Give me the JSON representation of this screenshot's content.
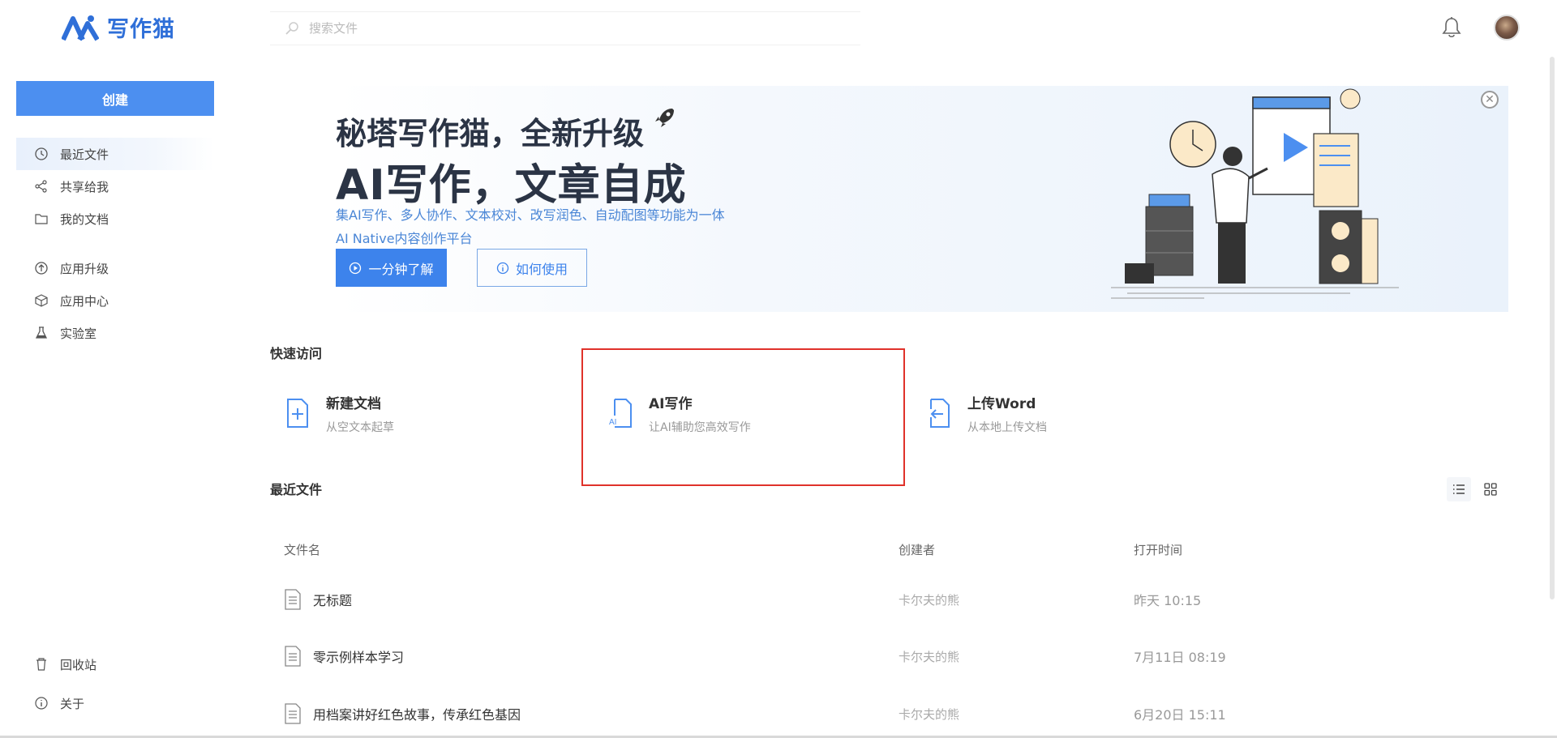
{
  "app": {
    "name": "写作猫"
  },
  "header": {
    "search_placeholder": "搜索文件"
  },
  "sidebar": {
    "create_label": "创建",
    "nav_primary": [
      {
        "label": "最近文件",
        "icon": "clock-icon",
        "active": true
      },
      {
        "label": "共享给我",
        "icon": "share-icon"
      },
      {
        "label": "我的文档",
        "icon": "folder-icon"
      }
    ],
    "nav_secondary": [
      {
        "label": "应用升级",
        "icon": "upgrade-icon"
      },
      {
        "label": "应用中心",
        "icon": "cube-icon"
      },
      {
        "label": "实验室",
        "icon": "flask-icon"
      }
    ],
    "nav_bottom": [
      {
        "label": "回收站",
        "icon": "trash-icon"
      },
      {
        "label": "关于",
        "icon": "info-icon"
      }
    ]
  },
  "banner": {
    "title1": "秘塔写作猫，全新升级",
    "title2": "AI写作，文章自成",
    "desc1": "集AI写作、多人协作、文本校对、改写润色、自动配图等功能为一体",
    "desc2": "AI Native内容创作平台",
    "btn_learn": "一分钟了解",
    "btn_howto": "如何使用"
  },
  "quick_access": {
    "title": "快速访问",
    "items": [
      {
        "name": "新建文档",
        "sub": "从空文本起草",
        "icon": "new-doc-icon"
      },
      {
        "name": "AI写作",
        "sub": "让AI辅助您高效写作",
        "icon": "ai-doc-icon",
        "highlighted": true
      },
      {
        "name": "上传Word",
        "sub": "从本地上传文档",
        "icon": "upload-doc-icon"
      }
    ]
  },
  "recent_files": {
    "title": "最近文件",
    "columns": {
      "name": "文件名",
      "creator": "创建者",
      "time": "打开时间"
    },
    "rows": [
      {
        "name": "无标题",
        "creator": "卡尔夫的熊",
        "time": "昨天 10:15"
      },
      {
        "name": "零示例样本学习",
        "creator": "卡尔夫的熊",
        "time": "7月11日 08:19"
      },
      {
        "name": "用档案讲好红色故事，传承红色基因",
        "creator": "卡尔夫的熊",
        "time": "6月20日 15:11"
      }
    ]
  },
  "colors": {
    "accent": "#3d83ec",
    "create_button": "#4c8ff0",
    "highlight": "#e0322a",
    "title_text": "#2b3445"
  }
}
